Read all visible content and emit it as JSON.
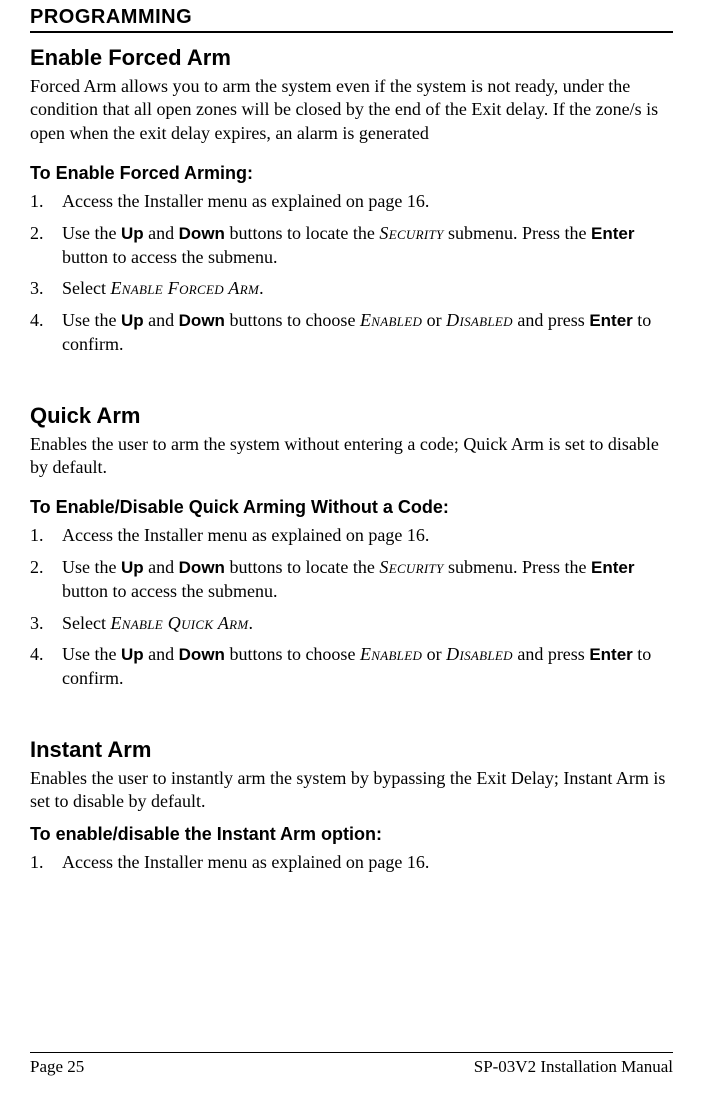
{
  "header": {
    "title": "PROGRAMMING"
  },
  "sections": {
    "forced": {
      "title": "Enable Forced Arm",
      "desc": "Forced Arm allows you to arm the system even if the system is not ready, under the condition that all open zones will be closed by the end of the Exit delay. If the zone/s is open when the exit delay expires, an alarm is generated",
      "sub": "To Enable Forced Arming:",
      "steps": {
        "s1": "Access the Installer menu as explained on page 16.",
        "s2a": "Use the ",
        "s2b": "Up",
        "s2c": " and ",
        "s2d": "Down",
        "s2e": " buttons to locate the ",
        "s2f": "Security",
        "s2g": " submenu. Press the ",
        "s2h": "Enter",
        "s2i": " button to access the submenu.",
        "s3a": "Select ",
        "s3b": "Enable Forced Arm",
        "s3c": ".",
        "s4a": "Use the ",
        "s4b": "Up",
        "s4c": " and ",
        "s4d": "Down",
        "s4e": " buttons to choose ",
        "s4f": "Enabled",
        "s4g": " or ",
        "s4h": "Disabled",
        "s4i": " and press ",
        "s4j": "Enter",
        "s4k": " to confirm."
      }
    },
    "quick": {
      "title": "Quick Arm",
      "desc": "Enables the user to arm the system without entering a code; Quick Arm is set to disable by default.",
      "sub": "To Enable/Disable Quick Arming Without a Code:",
      "steps": {
        "s1": "Access the Installer menu as explained on page 16.",
        "s2a": "Use the ",
        "s2b": "Up",
        "s2c": " and ",
        "s2d": "Down",
        "s2e": " buttons to locate the ",
        "s2f": "Security",
        "s2g": " submenu. Press the ",
        "s2h": "Enter",
        "s2i": " button to access the submenu.",
        "s3a": "Select ",
        "s3b": "Enable Quick Arm",
        "s3c": ".",
        "s4a": "Use the ",
        "s4b": "Up",
        "s4c": " and ",
        "s4d": "Down",
        "s4e": " buttons to choose ",
        "s4f": "Enabled",
        "s4g": " or ",
        "s4h": "Disabled",
        "s4i": " and press ",
        "s4j": "Enter",
        "s4k": " to confirm."
      }
    },
    "instant": {
      "title": "Instant Arm",
      "desc": "Enables the user to instantly arm the system by bypassing the Exit Delay; Instant Arm is set to disable by default.",
      "sub": "To enable/disable the Instant Arm option:",
      "steps": {
        "s1": "Access the Installer menu as explained on page 16."
      }
    }
  },
  "footer": {
    "left": "Page 25",
    "right": "SP-03V2 Installation Manual"
  },
  "nums": {
    "n1": "1.",
    "n2": "2.",
    "n3": "3.",
    "n4": "4."
  }
}
